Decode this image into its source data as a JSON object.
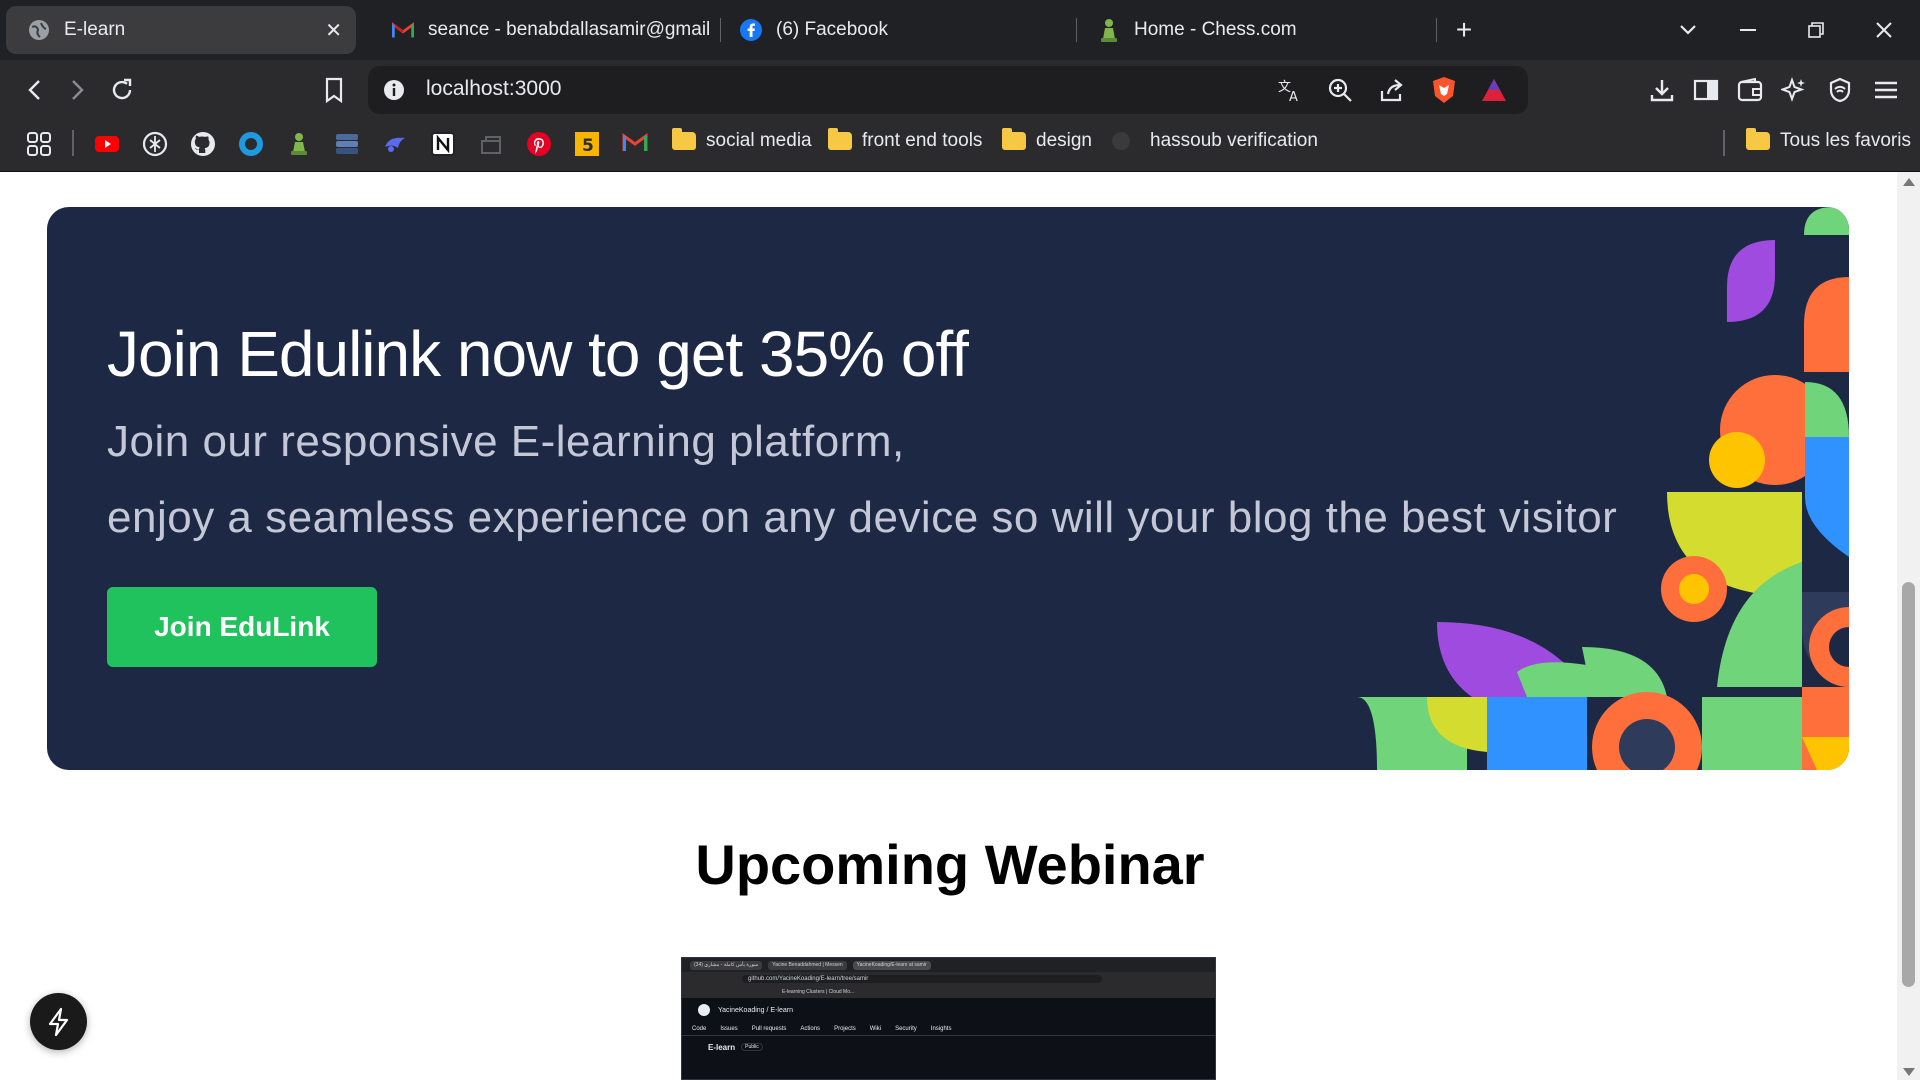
{
  "browser": {
    "tabs": [
      {
        "title": "E-learn",
        "favicon": "globe-icon",
        "active": true
      },
      {
        "title": "seance - benabdallasamir@gmail.co",
        "favicon": "gmail-icon",
        "active": false
      },
      {
        "title": "(6) Facebook",
        "favicon": "facebook-icon",
        "active": false
      },
      {
        "title": "Home - Chess.com",
        "favicon": "chess-pawn-icon",
        "active": false
      }
    ],
    "new_tab": "+",
    "address": "localhost:3000",
    "bookmarks": {
      "folders": [
        {
          "label": "social media"
        },
        {
          "label": "front end tools"
        },
        {
          "label": "design"
        },
        {
          "label": "hassoub verification"
        }
      ],
      "all_bookmarks": "Tous les favoris",
      "icons": [
        "youtube-icon",
        "openai-icon",
        "github-icon",
        "circle-app-icon",
        "chess-icon",
        "server-icon",
        "codeium-icon",
        "notion-icon",
        "generic-app-icon",
        "pinterest-icon",
        "html5-icon",
        "gmail-icon"
      ]
    }
  },
  "page": {
    "banner": {
      "title": "Join Edulink now to get 35% off",
      "subtitle_line1": "Join our responsive E-learning platform,",
      "subtitle_line2": "enjoy a seamless experience on any device so will your blog the best visitor",
      "cta_label": "Join EduLink"
    },
    "webinar": {
      "heading": "Upcoming Webinar",
      "thumb": {
        "tab1": "(34) سورة يأس كاملة - مشاري",
        "tab2": "Yacine Benaddahmed | Messen",
        "tab3": "YacineKoading/E-learn at samir",
        "url": "github.com/YacineKoading/E-learn/tree/samir",
        "bookmarks": "E-learning   Clusters | Cloud Mo...",
        "gh_path": "YacineKoading / E-learn",
        "gh_nav": [
          "Code",
          "Issues",
          "Pull requests",
          "Actions",
          "Projects",
          "Wiki",
          "Security",
          "Insights"
        ],
        "repo_name": "E-learn",
        "repo_badge": "Public"
      }
    }
  },
  "colors": {
    "banner_bg": "#1d2844",
    "cta_green": "#1fc25c",
    "browser_dark": "#202124"
  }
}
